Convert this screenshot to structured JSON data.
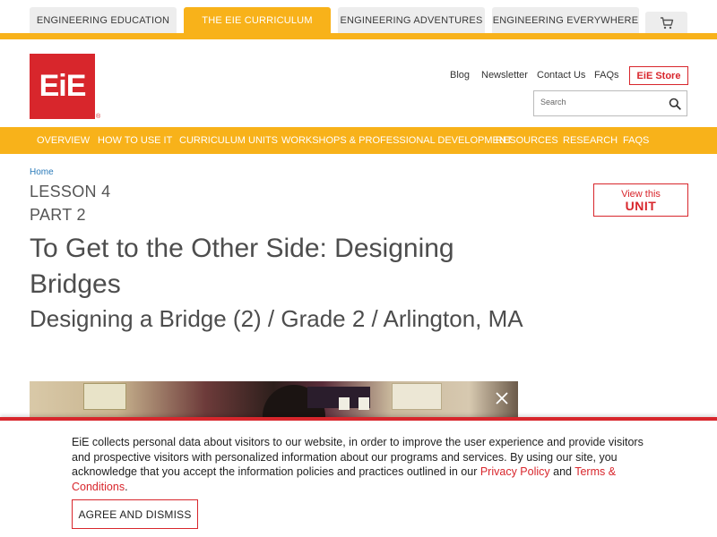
{
  "top_tabs": [
    {
      "label": "ENGINEERING EDUCATION",
      "active": false
    },
    {
      "label": "THE EIE CURRICULUM",
      "active": true
    },
    {
      "label": "ENGINEERING ADVENTURES",
      "active": false
    },
    {
      "label": "ENGINEERING EVERYWHERE",
      "active": false
    }
  ],
  "cart_icon": "cart-icon",
  "logo": {
    "text": "EiE",
    "registered": "®"
  },
  "util_links": [
    "Blog",
    "Newsletter",
    "Contact Us",
    "FAQs"
  ],
  "store_button": "EiE Store",
  "search": {
    "placeholder": "Search",
    "icon": "search-icon"
  },
  "main_nav": [
    "OVERVIEW",
    "HOW TO USE IT",
    "CURRICULUM UNITS",
    "WORKSHOPS & PROFESSIONAL DEVELOPMENT",
    "RESOURCES",
    "RESEARCH",
    "FAQS"
  ],
  "breadcrumb": "Home",
  "lesson": "LESSON 4",
  "part": "PART 2",
  "title": "To Get to the Other Side: Designing Bridges",
  "subtitle": "Designing a Bridge (2) / Grade 2 / Arlington, MA",
  "view_unit": {
    "line1": "View this",
    "line2": "UNIT"
  },
  "video_close_icon": "close-icon",
  "cookie": {
    "text_before": "EiE collects personal data about visitors to our website, in order to improve the user experience and provide visitors and prospective visitors with personalized information about our programs and services. By using our site, you acknowledge that you accept the information policies and practices outlined in our ",
    "privacy_link": "Privacy Policy",
    "and": " and ",
    "terms_link": "Terms & Conditions",
    "period": ".",
    "button": "AGREE AND DISMISS"
  },
  "colors": {
    "brand_red": "#d8262c",
    "gold": "#f8b21a",
    "link_blue": "#2a7ab9"
  }
}
